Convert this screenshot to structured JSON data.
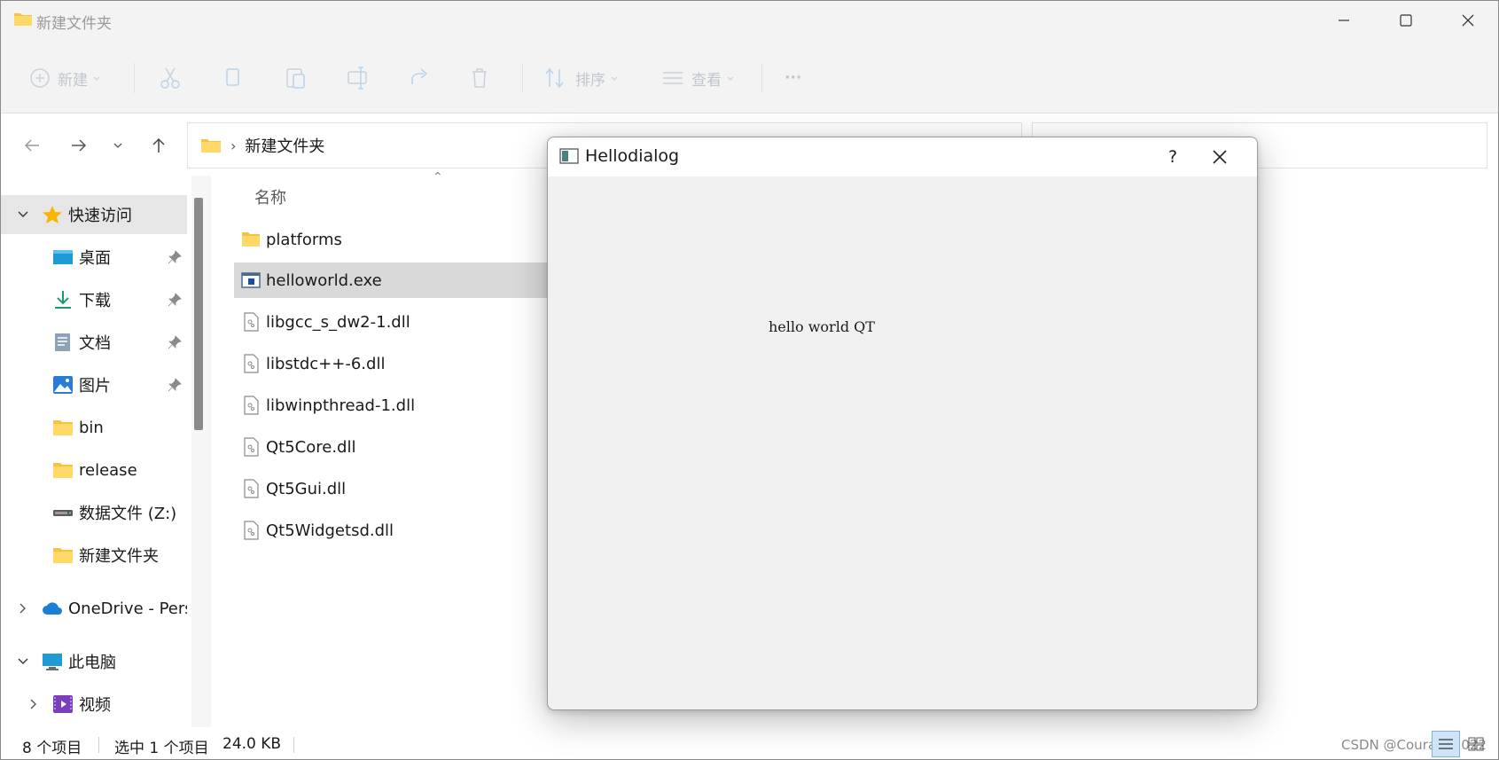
{
  "window": {
    "title": "新建文件夹",
    "folder_color": "#f5c242"
  },
  "ribbon": {
    "new_label": "新建",
    "sort_label": "排序",
    "view_label": "查看",
    "more_label": "···"
  },
  "address": {
    "separator": "›",
    "current": "新建文件夹"
  },
  "sidebar": {
    "quick_access": "快速访问",
    "items": [
      {
        "label": "桌面",
        "icon": "desktop-icon",
        "pinned": true
      },
      {
        "label": "下载",
        "icon": "download-icon",
        "pinned": true
      },
      {
        "label": "文档",
        "icon": "document-icon",
        "pinned": true
      },
      {
        "label": "图片",
        "icon": "pictures-icon",
        "pinned": true
      },
      {
        "label": "bin",
        "icon": "folder-icon",
        "pinned": false
      },
      {
        "label": "release",
        "icon": "folder-icon",
        "pinned": false
      },
      {
        "label": "数据文件 (Z:)",
        "icon": "drive-icon",
        "pinned": false
      },
      {
        "label": "新建文件夹",
        "icon": "folder-icon",
        "pinned": false
      }
    ],
    "onedrive": "OneDrive - Pers",
    "this_pc": "此电脑",
    "videos": "视频"
  },
  "content": {
    "column_name": "名称",
    "files": [
      {
        "name": "platforms",
        "type": "folder"
      },
      {
        "name": "helloworld.exe",
        "type": "exe",
        "selected": true
      },
      {
        "name": "libgcc_s_dw2-1.dll",
        "type": "dll"
      },
      {
        "name": "libstdc++-6.dll",
        "type": "dll"
      },
      {
        "name": "libwinpthread-1.dll",
        "type": "dll"
      },
      {
        "name": "Qt5Core.dll",
        "type": "dll"
      },
      {
        "name": "Qt5Gui.dll",
        "type": "dll"
      },
      {
        "name": "Qt5Widgetsd.dll",
        "type": "dll"
      }
    ]
  },
  "status": {
    "count": "8 个项目",
    "selection": "选中 1 个项目",
    "size": "24.0 KB",
    "watermark": "CSDN @Courage2022"
  },
  "dialog": {
    "title": "Hellodialog",
    "help": "?",
    "label": "hello world QT"
  }
}
